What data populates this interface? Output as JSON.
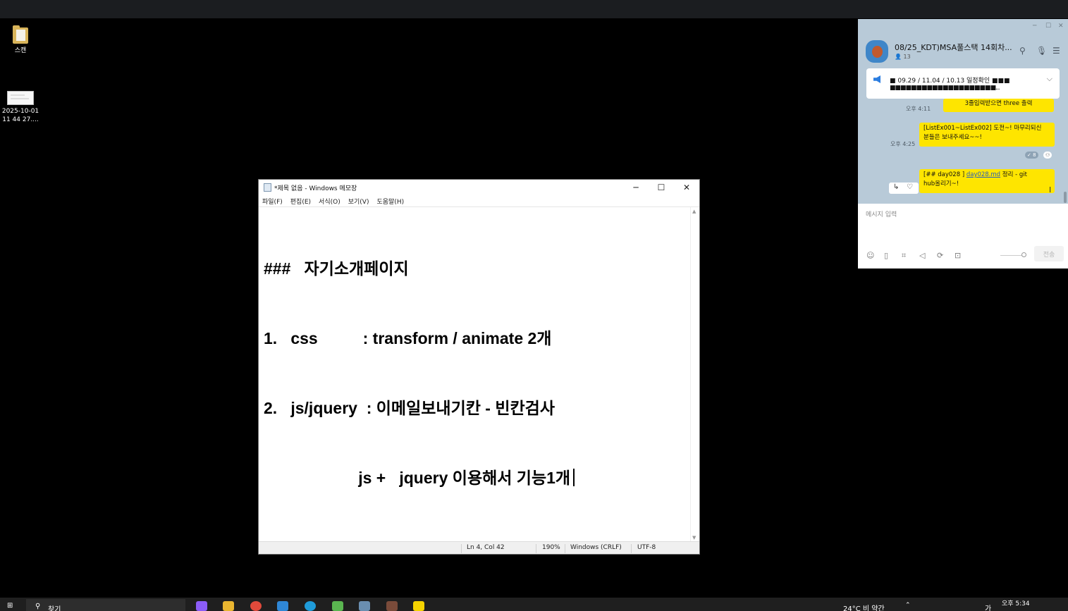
{
  "desktop": {
    "icons": [
      {
        "label": "스캔"
      },
      {
        "label": "2025-10-01 11 44 27...."
      }
    ]
  },
  "notepad": {
    "title": "*제목 없음 - Windows 메모장",
    "controls": {
      "minimize": "─",
      "maximize": "☐",
      "close": "✕"
    },
    "menu": [
      "파일(F)",
      "편집(E)",
      "서식(O)",
      "보기(V)",
      "도움말(H)"
    ],
    "lines": [
      "###   자기소개페이지",
      "1.   css          : transform / animate 2개",
      "2.   js/jquery  : 이메일보내기칸 - 빈칸검사",
      "                     js +   jquery 이용해서 기능1개"
    ],
    "status": {
      "position": "Ln 4, Col 42",
      "zoom": "190%",
      "line_ending": "Windows (CRLF)",
      "encoding": "UTF-8"
    }
  },
  "kakao": {
    "room_title": "08/25_KDT)MSA풀스택 14회차...",
    "member_count": "13",
    "notice_line1": "■   09.29 / 11.04 / 10.13 일정확인   ■■■",
    "notice_line2": "■■■■■■■■■■■■■■■■■■■■...",
    "messages": [
      {
        "time": "오후 4:11",
        "text": "3줄입력받으면 three 출력"
      },
      {
        "time": "오후 4:25",
        "text1": "[ListEx001~ListEx002]  도전~! 마무리되신",
        "text2": "분들은 보내주세요~~!",
        "read": "8"
      },
      {
        "pre": "[##  day028 ]  ",
        "link": "day028.md",
        "post": " 정리  - git",
        "text2": "hub올리기~!"
      }
    ],
    "input_placeholder": "메시지 입력",
    "send_label": "전송"
  },
  "taskbar": {
    "search_placeholder": "찾기",
    "weather": "24°C  비 약간",
    "time": "오후 5:34",
    "ime": "가"
  }
}
